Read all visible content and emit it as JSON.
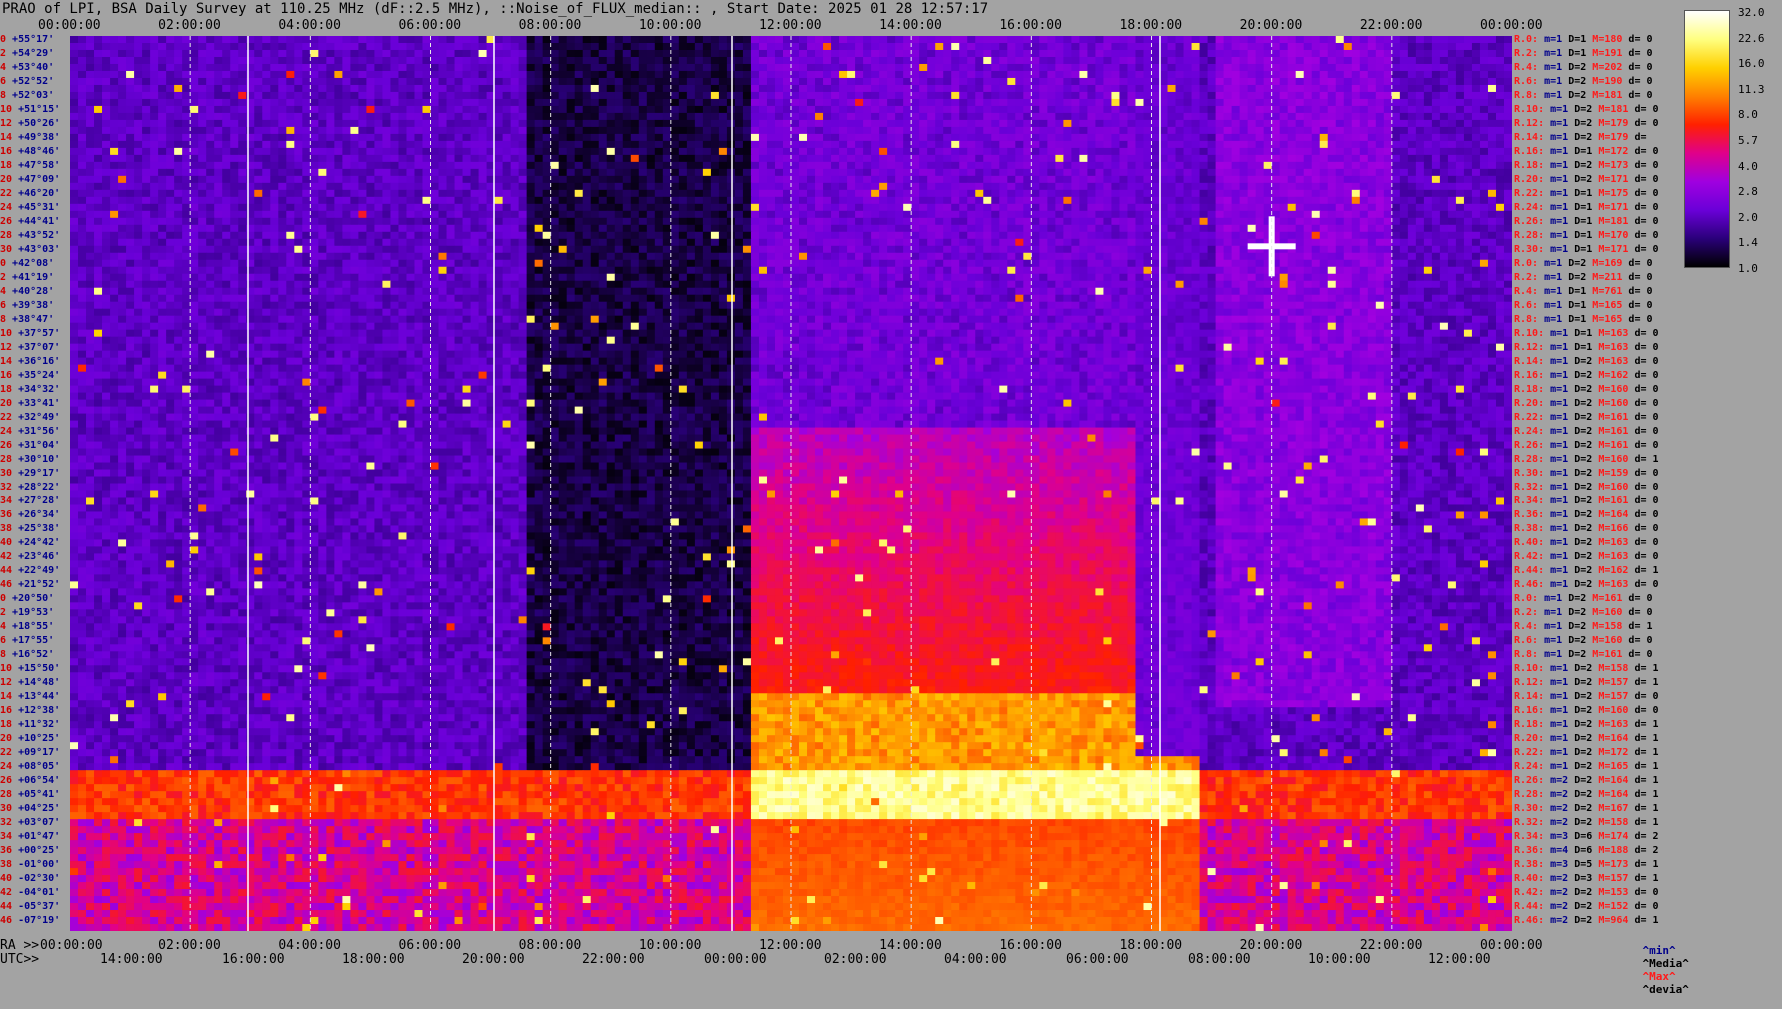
{
  "title": "PRAO of LPI, BSA Daily Survey at 110.25 MHz (dF::2.5 MHz), ::Noise_of_FLUX_median:: , Start Date: 2025 01 28 12:57:17",
  "top_axis_ticks": [
    "00:00:00",
    "02:00:00",
    "04:00:00",
    "06:00:00",
    "08:00:00",
    "10:00:00",
    "12:00:00",
    "14:00:00",
    "16:00:00",
    "18:00:00",
    "20:00:00",
    "22:00:00",
    "00:00:00"
  ],
  "ra_label": "RA >>",
  "ra_ticks": [
    "00:00:00",
    "02:00:00",
    "04:00:00",
    "06:00:00",
    "08:00:00",
    "10:00:00",
    "12:00:00",
    "14:00:00",
    "16:00:00",
    "18:00:00",
    "20:00:00",
    "22:00:00",
    "00:00:00"
  ],
  "utc_label": "UTC>>",
  "utc_ticks": [
    "14:0",
    "0:00",
    "16:0",
    "0:00",
    "18:0",
    "0:00",
    "20:0",
    "0:00",
    "22:0",
    "0:00",
    "00:0",
    "0:00",
    "02:0",
    "0:00",
    "04:0",
    "0:00",
    "06:0",
    "0:00",
    "08:0",
    "0:00",
    "10:0",
    "0:00",
    "12:0",
    "0:00"
  ],
  "utc_ticks_text": [
    "14:00:00",
    "16:00:00",
    "18:00:00",
    "20:00:00",
    "22:00:00",
    "00:00:00",
    "02:00:00",
    "04:00:00",
    "06:00:00",
    "08:00:00",
    "10:00:00",
    "12:00:00"
  ],
  "declinations": [
    "+55°17'",
    "+54°29'",
    "+53°40'",
    "+52°52'",
    "+52°03'",
    "+51°15'",
    "+50°26'",
    "+49°38'",
    "+48°46'",
    "+47°58'",
    "+47°09'",
    "+46°20'",
    "+45°31'",
    "+44°41'",
    "+43°52'",
    "+43°03'",
    "+42°08'",
    "+41°19'",
    "+40°28'",
    "+39°38'",
    "+38°47'",
    "+37°57'",
    "+37°07'",
    "+36°16'",
    "+35°24'",
    "+34°32'",
    "+33°41'",
    "+32°49'",
    "+31°56'",
    "+31°04'",
    "+30°10'",
    "+29°17'",
    "+28°22'",
    "+27°28'",
    "+26°34'",
    "+25°38'",
    "+24°42'",
    "+23°46'",
    "+22°49'",
    "+21°52'",
    "+20°50'",
    "+19°53'",
    "+18°55'",
    "+17°55'",
    "+16°52'",
    "+15°50'",
    "+14°48'",
    "+13°44'",
    "+12°38'",
    "+11°32'",
    "+10°25'",
    "+09°17'",
    "+08°05'",
    "+06°54'",
    "+05°41'",
    "+04°25'",
    "+03°07'",
    "+01°47'",
    "+00°25'",
    "-01°00'",
    "-02°30'",
    "-04°01'",
    "-05°37'",
    "-07°19'"
  ],
  "dec_indices": [
    "0",
    "2",
    "4",
    "6",
    "8",
    "10",
    "12",
    "14",
    "16",
    "18",
    "20",
    "22",
    "24",
    "26",
    "28",
    "30",
    "0",
    "2",
    "4",
    "6",
    "8",
    "10",
    "12",
    "14",
    "16",
    "18",
    "20",
    "22",
    "24",
    "26",
    "28",
    "30",
    "32",
    "34",
    "36",
    "38",
    "40",
    "42",
    "44",
    "46",
    "0",
    "2",
    "4",
    "6",
    "8",
    "10",
    "12",
    "14",
    "16",
    "18",
    "20",
    "22",
    "24",
    "26",
    "28",
    "30",
    "32",
    "34",
    "36",
    "38",
    "40",
    "42",
    "44",
    "46"
  ],
  "rows": [
    {
      "r": "R.0:",
      "m": "m=1",
      "D": "D=1",
      "M": "M=180",
      "d": "d= 0"
    },
    {
      "r": "R.2:",
      "m": "m=1",
      "D": "D=1",
      "M": "M=191",
      "d": "d= 0"
    },
    {
      "r": "R.4:",
      "m": "m=1",
      "D": "D=2",
      "M": "M=202",
      "d": "d= 0"
    },
    {
      "r": "R.6:",
      "m": "m=1",
      "D": "D=2",
      "M": "M=190",
      "d": "d= 0"
    },
    {
      "r": "R.8:",
      "m": "m=1",
      "D": "D=2",
      "M": "M=181",
      "d": "d= 0"
    },
    {
      "r": "R.10:",
      "m": "m=1",
      "D": "D=2",
      "M": "M=181",
      "d": "d= 0"
    },
    {
      "r": "R.12:",
      "m": "m=1",
      "D": "D=2",
      "M": "M=179",
      "d": "d= 0"
    },
    {
      "r": "R.14:",
      "m": "m=1",
      "D": "D=2",
      "M": "M=179",
      "d": "d="
    },
    {
      "r": "R.16:",
      "m": "m=1",
      "D": "D=1",
      "M": "M=172",
      "d": "d= 0"
    },
    {
      "r": "R.18:",
      "m": "m=1",
      "D": "D=2",
      "M": "M=173",
      "d": "d= 0"
    },
    {
      "r": "R.20:",
      "m": "m=1",
      "D": "D=2",
      "M": "M=171",
      "d": "d= 0"
    },
    {
      "r": "R.22:",
      "m": "m=1",
      "D": "D=1",
      "M": "M=175",
      "d": "d= 0"
    },
    {
      "r": "R.24:",
      "m": "m=1",
      "D": "D=1",
      "M": "M=171",
      "d": "d= 0"
    },
    {
      "r": "R.26:",
      "m": "m=1",
      "D": "D=1",
      "M": "M=181",
      "d": "d= 0"
    },
    {
      "r": "R.28:",
      "m": "m=1",
      "D": "D=1",
      "M": "M=170",
      "d": "d= 0"
    },
    {
      "r": "R.30:",
      "m": "m=1",
      "D": "D=1",
      "M": "M=171",
      "d": "d= 0"
    },
    {
      "r": "R.0:",
      "m": "m=1",
      "D": "D=2",
      "M": "M=169",
      "d": "d= 0"
    },
    {
      "r": "R.2:",
      "m": "m=1",
      "D": "D=2",
      "M": "M=211",
      "d": "d= 0"
    },
    {
      "r": "R.4:",
      "m": "m=1",
      "D": "D=1",
      "M": "M=761",
      "d": "d= 0"
    },
    {
      "r": "R.6:",
      "m": "m=1",
      "D": "D=1",
      "M": "M=165",
      "d": "d= 0"
    },
    {
      "r": "R.8:",
      "m": "m=1",
      "D": "D=1",
      "M": "M=165",
      "d": "d= 0"
    },
    {
      "r": "R.10:",
      "m": "m=1",
      "D": "D=1",
      "M": "M=163",
      "d": "d= 0"
    },
    {
      "r": "R.12:",
      "m": "m=1",
      "D": "D=1",
      "M": "M=163",
      "d": "d= 0"
    },
    {
      "r": "R.14:",
      "m": "m=1",
      "D": "D=2",
      "M": "M=163",
      "d": "d= 0"
    },
    {
      "r": "R.16:",
      "m": "m=1",
      "D": "D=2",
      "M": "M=162",
      "d": "d= 0"
    },
    {
      "r": "R.18:",
      "m": "m=1",
      "D": "D=2",
      "M": "M=160",
      "d": "d= 0"
    },
    {
      "r": "R.20:",
      "m": "m=1",
      "D": "D=2",
      "M": "M=160",
      "d": "d= 0"
    },
    {
      "r": "R.22:",
      "m": "m=1",
      "D": "D=2",
      "M": "M=161",
      "d": "d= 0"
    },
    {
      "r": "R.24:",
      "m": "m=1",
      "D": "D=2",
      "M": "M=161",
      "d": "d= 0"
    },
    {
      "r": "R.26:",
      "m": "m=1",
      "D": "D=2",
      "M": "M=161",
      "d": "d= 0"
    },
    {
      "r": "R.28:",
      "m": "m=1",
      "D": "D=2",
      "M": "M=160",
      "d": "d= 1"
    },
    {
      "r": "R.30:",
      "m": "m=1",
      "D": "D=2",
      "M": "M=159",
      "d": "d= 0"
    },
    {
      "r": "R.32:",
      "m": "m=1",
      "D": "D=2",
      "M": "M=160",
      "d": "d= 0"
    },
    {
      "r": "R.34:",
      "m": "m=1",
      "D": "D=2",
      "M": "M=161",
      "d": "d= 0"
    },
    {
      "r": "R.36:",
      "m": "m=1",
      "D": "D=2",
      "M": "M=164",
      "d": "d= 0"
    },
    {
      "r": "R.38:",
      "m": "m=1",
      "D": "D=2",
      "M": "M=166",
      "d": "d= 0"
    },
    {
      "r": "R.40:",
      "m": "m=1",
      "D": "D=2",
      "M": "M=163",
      "d": "d= 0"
    },
    {
      "r": "R.42:",
      "m": "m=1",
      "D": "D=2",
      "M": "M=163",
      "d": "d= 0"
    },
    {
      "r": "R.44:",
      "m": "m=1",
      "D": "D=2",
      "M": "M=162",
      "d": "d= 1"
    },
    {
      "r": "R.46:",
      "m": "m=1",
      "D": "D=2",
      "M": "M=163",
      "d": "d= 0"
    },
    {
      "r": "R.0:",
      "m": "m=1",
      "D": "D=2",
      "M": "M=161",
      "d": "d= 0"
    },
    {
      "r": "R.2:",
      "m": "m=1",
      "D": "D=2",
      "M": "M=160",
      "d": "d= 0"
    },
    {
      "r": "R.4:",
      "m": "m=1",
      "D": "D=2",
      "M": "M=158",
      "d": "d= 1"
    },
    {
      "r": "R.6:",
      "m": "m=1",
      "D": "D=2",
      "M": "M=160",
      "d": "d= 0"
    },
    {
      "r": "R.8:",
      "m": "m=1",
      "D": "D=2",
      "M": "M=161",
      "d": "d= 0"
    },
    {
      "r": "R.10:",
      "m": "m=1",
      "D": "D=2",
      "M": "M=158",
      "d": "d= 1"
    },
    {
      "r": "R.12:",
      "m": "m=1",
      "D": "D=2",
      "M": "M=157",
      "d": "d= 1"
    },
    {
      "r": "R.14:",
      "m": "m=1",
      "D": "D=2",
      "M": "M=157",
      "d": "d= 0"
    },
    {
      "r": "R.16:",
      "m": "m=1",
      "D": "D=2",
      "M": "M=160",
      "d": "d= 0"
    },
    {
      "r": "R.18:",
      "m": "m=1",
      "D": "D=2",
      "M": "M=163",
      "d": "d= 1"
    },
    {
      "r": "R.20:",
      "m": "m=1",
      "D": "D=2",
      "M": "M=164",
      "d": "d= 1"
    },
    {
      "r": "R.22:",
      "m": "m=1",
      "D": "D=2",
      "M": "M=172",
      "d": "d= 1"
    },
    {
      "r": "R.24:",
      "m": "m=1",
      "D": "D=2",
      "M": "M=165",
      "d": "d= 1"
    },
    {
      "r": "R.26:",
      "m": "m=2",
      "D": "D=2",
      "M": "M=164",
      "d": "d= 1"
    },
    {
      "r": "R.28:",
      "m": "m=2",
      "D": "D=2",
      "M": "M=164",
      "d": "d= 1"
    },
    {
      "r": "R.30:",
      "m": "m=2",
      "D": "D=2",
      "M": "M=167",
      "d": "d= 1"
    },
    {
      "r": "R.32:",
      "m": "m=2",
      "D": "D=2",
      "M": "M=158",
      "d": "d= 1"
    },
    {
      "r": "R.34:",
      "m": "m=3",
      "D": "D=6",
      "M": "M=174",
      "d": "d= 2"
    },
    {
      "r": "R.36:",
      "m": "m=4",
      "D": "D=6",
      "M": "M=188",
      "d": "d= 2"
    },
    {
      "r": "R.38:",
      "m": "m=3",
      "D": "D=5",
      "M": "M=173",
      "d": "d= 1"
    },
    {
      "r": "R.40:",
      "m": "m=2",
      "D": "D=3",
      "M": "M=157",
      "d": "d= 1"
    },
    {
      "r": "R.42:",
      "m": "m=2",
      "D": "D=2",
      "M": "M=153",
      "d": "d= 0"
    },
    {
      "r": "R.44:",
      "m": "m=2",
      "D": "D=2",
      "M": "M=152",
      "d": "d= 0"
    },
    {
      "r": "R.46:",
      "m": "m=2",
      "D": "D=2",
      "M": "M=964",
      "d": "d= 1"
    }
  ],
  "legend_foot": {
    "min": "^min^",
    "media": "^Media^",
    "max": "^Max^",
    "devia": "^devia^"
  },
  "colorbar": {
    "ticks": [
      "32.0",
      "22.6",
      "16.0",
      "11.3",
      "8.0",
      "5.7",
      "4.0",
      "2.8",
      "2.0",
      "1.4",
      "1.0"
    ],
    "stops": [
      "#ffffff",
      "#ffff80",
      "#ffd000",
      "#ff8000",
      "#ff2000",
      "#e0008a",
      "#a000e0",
      "#6a00d8",
      "#2a007a",
      "#000000"
    ]
  },
  "chart_data": {
    "type": "heatmap",
    "title": "PRAO of LPI, BSA Daily Survey at 110.25 MHz (dF::2.5 MHz), ::Noise_of_FLUX_median:: , Start Date: 2025 01 28 12:57:17",
    "x_axis": {
      "label": "RA >>",
      "range": [
        "00:00:00",
        "24:00:00"
      ],
      "ticks": [
        "00:00:00",
        "02:00:00",
        "04:00:00",
        "06:00:00",
        "08:00:00",
        "10:00:00",
        "12:00:00",
        "14:00:00",
        "16:00:00",
        "18:00:00",
        "20:00:00",
        "22:00:00",
        "00:00:00"
      ]
    },
    "x2_axis": {
      "label": "UTC>>",
      "ticks": [
        "14:00:00",
        "16:00:00",
        "18:00:00",
        "20:00:00",
        "22:00:00",
        "00:00:00",
        "02:00:00",
        "04:00:00",
        "06:00:00",
        "08:00:00",
        "10:00:00",
        "12:00:00"
      ]
    },
    "y_axis": {
      "range": [
        "+55°17'",
        "-07°19'"
      ]
    },
    "colorscale": {
      "min": 1.0,
      "max": 32.0,
      "scale": "log"
    },
    "features": [
      {
        "name": "bright band",
        "dec": "+01°47' to -01°00'",
        "ra": "00:00-24:00",
        "peak_ra": "11:30-16:00"
      },
      {
        "name": "enhanced region",
        "ra": "11:30-18:45",
        "dec": "+31°56' to -07°19'"
      },
      {
        "name": "dark region",
        "ra": "07:30-11:30",
        "dec": "all"
      },
      {
        "name": "point source",
        "ra": "~20:00",
        "dec": "~+41°19'",
        "level": 32.0
      }
    ]
  }
}
